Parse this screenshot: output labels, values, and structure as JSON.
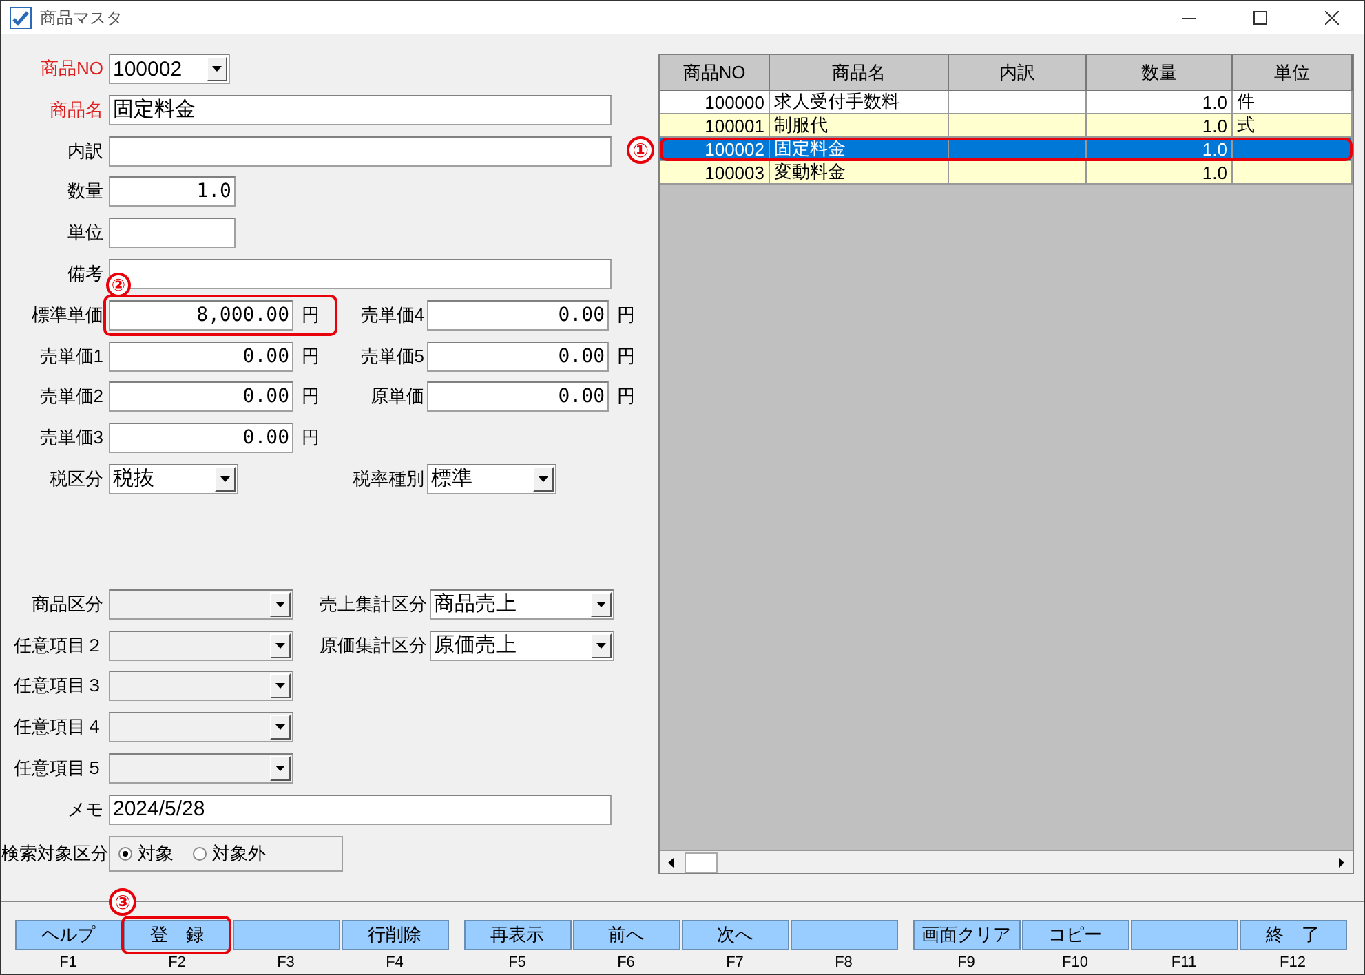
{
  "window": {
    "title": "商品マスタ"
  },
  "top_fields": [
    {
      "kind": "combo",
      "label": "商品NO",
      "required": true,
      "value": "100002"
    },
    {
      "kind": "wide",
      "label": "商品名",
      "required": true,
      "value": "固定料金"
    },
    {
      "kind": "wide",
      "label": "内訳",
      "required": false
    },
    {
      "kind": "short",
      "label": "数量",
      "required": false,
      "value": "1.0"
    },
    {
      "kind": "short",
      "label": "単位",
      "required": false
    },
    {
      "kind": "wide",
      "label": "備考",
      "required": false
    }
  ],
  "prices_left": [
    {
      "label": "標準単価",
      "value": "8,000.00",
      "unit": "円",
      "callout": "②"
    },
    {
      "label": "売単価1",
      "value": "0.00",
      "unit": "円"
    },
    {
      "label": "売単価2",
      "value": "0.00",
      "unit": "円"
    },
    {
      "label": "売単価3",
      "value": "0.00",
      "unit": "円"
    }
  ],
  "prices_right": [
    {
      "label": "売単価4",
      "value": "0.00",
      "unit": "円"
    },
    {
      "label": "売単価5",
      "value": "0.00",
      "unit": "円"
    },
    {
      "label": "原単価",
      "value": "0.00",
      "unit": "円"
    }
  ],
  "tax": [
    {
      "label": "税区分",
      "value": "税抜"
    },
    {
      "label": "税率種別",
      "value": "標準"
    }
  ],
  "categories_left": [
    {
      "label": "商品区分"
    },
    {
      "label": "任意項目２"
    },
    {
      "label": "任意項目３"
    },
    {
      "label": "任意項目４"
    },
    {
      "label": "任意項目５"
    }
  ],
  "categories_right": [
    {
      "label": "売上集計区分",
      "value": "商品売上"
    },
    {
      "label": "原価集計区分",
      "value": "原価売上"
    }
  ],
  "memo": {
    "label": "メモ",
    "value": "2024/5/28"
  },
  "search_target": {
    "label": "検索対象区分",
    "options": [
      {
        "label": "対象",
        "selected": true
      },
      {
        "label": "対象外",
        "selected": false
      }
    ]
  },
  "grid": {
    "columns": [
      "商品NO",
      "商品名",
      "内訳",
      "数量",
      "単位"
    ],
    "rows": [
      {
        "cells": [
          "100000",
          "求人受付手数料",
          "",
          "1.0",
          "件"
        ],
        "selected": false
      },
      {
        "cells": [
          "100001",
          "制服代",
          "",
          "1.0",
          "式"
        ],
        "selected": false
      },
      {
        "cells": [
          "100002",
          "固定料金",
          "",
          "1.0",
          ""
        ],
        "selected": true,
        "callout": "①"
      },
      {
        "cells": [
          "100003",
          "変動料金",
          "",
          "1.0",
          ""
        ],
        "selected": false
      }
    ]
  },
  "function_keys": [
    {
      "label": "ヘルプ",
      "key": "F1"
    },
    {
      "label": "登　録",
      "key": "F2",
      "callout": "③"
    },
    {
      "key": "F3"
    },
    {
      "label": "行削除",
      "key": "F4"
    },
    {
      "label": "再表示",
      "key": "F5"
    },
    {
      "label": "前へ",
      "key": "F6"
    },
    {
      "label": "次へ",
      "key": "F7"
    },
    {
      "key": "F8"
    },
    {
      "label": "画面クリア",
      "key": "F9"
    },
    {
      "label": "コピー",
      "key": "F10"
    },
    {
      "key": "F11"
    },
    {
      "label": "終　了",
      "key": "F12"
    }
  ]
}
